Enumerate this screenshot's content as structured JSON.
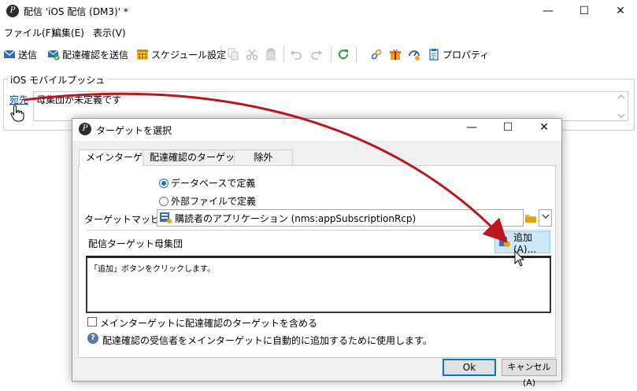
{
  "window": {
    "title": "配信 'iOS 配信 (DM3)' *",
    "app_icon_glyph": "P",
    "minimize_glyph": "—",
    "maximize_glyph": "☐",
    "close_glyph": "✕"
  },
  "menu": {
    "items": [
      "ファイル(F)",
      "編集(E)",
      "表示(V)"
    ]
  },
  "toolbar": {
    "send": "送信",
    "send_proof": "配達確認を送信",
    "schedule": "スケジュール設定",
    "properties": "プロパティ"
  },
  "group": {
    "legend": "iOS モバイルプッシュ",
    "to_link": "宛先",
    "to_value": "母集団が未定義です"
  },
  "dialog": {
    "title": "ターゲットを選択",
    "tabs": [
      "メインターゲット",
      "配達確認のターゲット",
      "除外"
    ],
    "radio_db": "データベースで定義",
    "radio_file": "外部ファイルで定義",
    "mapping_label": "ターゲットマッピング:",
    "mapping_value": "購読者のアプリケーション (nms:appSubscriptionRcp)",
    "population_label": "配信ターゲット母集団",
    "add_button": "追加(A)...",
    "population_hint": "「追加」ボタンをクリックします。",
    "include_proof_label": "メインターゲットに配達確認のターゲットを含める",
    "help_text": "配達確認の受信者をメインターゲットに自動的に追加するために使用します。",
    "ok": "Ok",
    "cancel": "キャンセル(A)"
  },
  "colors": {
    "arrow": "#c0141c",
    "accent": "#1d6fd3",
    "add_button_bg": "#cde8f7"
  }
}
